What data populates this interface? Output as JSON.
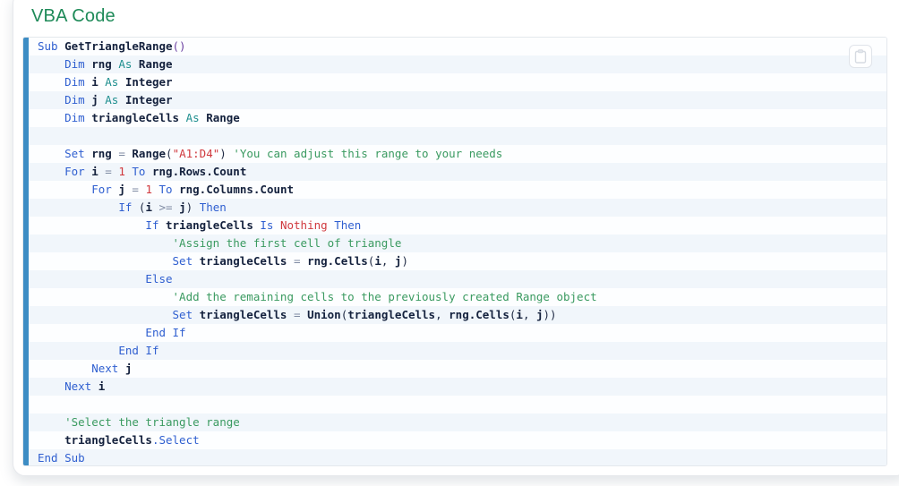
{
  "card": {
    "title": "VBA Code"
  },
  "toolbar": {
    "copy_icon": "clipboard-icon",
    "copy_tooltip": "Copy"
  },
  "colors": {
    "title": "#1e8a58",
    "accent_bar": "#3d8dc4",
    "stripe_alt": "#f1f6fb",
    "keyword": "#2f5fd0",
    "type": "#1f8f8f",
    "identifier": "#14213d",
    "string": "#d0393e",
    "comment": "#3a9a60",
    "punctuation": "#6a3fa0",
    "operator": "#7f8ba3"
  },
  "code": {
    "language": "vba",
    "line_count": 24,
    "lines": [
      "Sub GetTriangleRange()",
      "    Dim rng As Range",
      "    Dim i As Integer",
      "    Dim j As Integer",
      "    Dim triangleCells As Range",
      "",
      "    Set rng = Range(\"A1:D4\") 'You can adjust this range to your needs",
      "    For i = 1 To rng.Rows.Count",
      "        For j = 1 To rng.Columns.Count",
      "            If (i >= j) Then",
      "                If triangleCells Is Nothing Then",
      "                    'Assign the first cell of triangle",
      "                    Set triangleCells = rng.Cells(i, j)",
      "                Else",
      "                    'Add the remaining cells to the previously created Range object",
      "                    Set triangleCells = Union(triangleCells, rng.Cells(i, j))",
      "                End If",
      "            End If",
      "        Next j",
      "    Next i",
      "",
      "    'Select the triangle range",
      "    triangleCells.Select",
      "End Sub"
    ]
  }
}
